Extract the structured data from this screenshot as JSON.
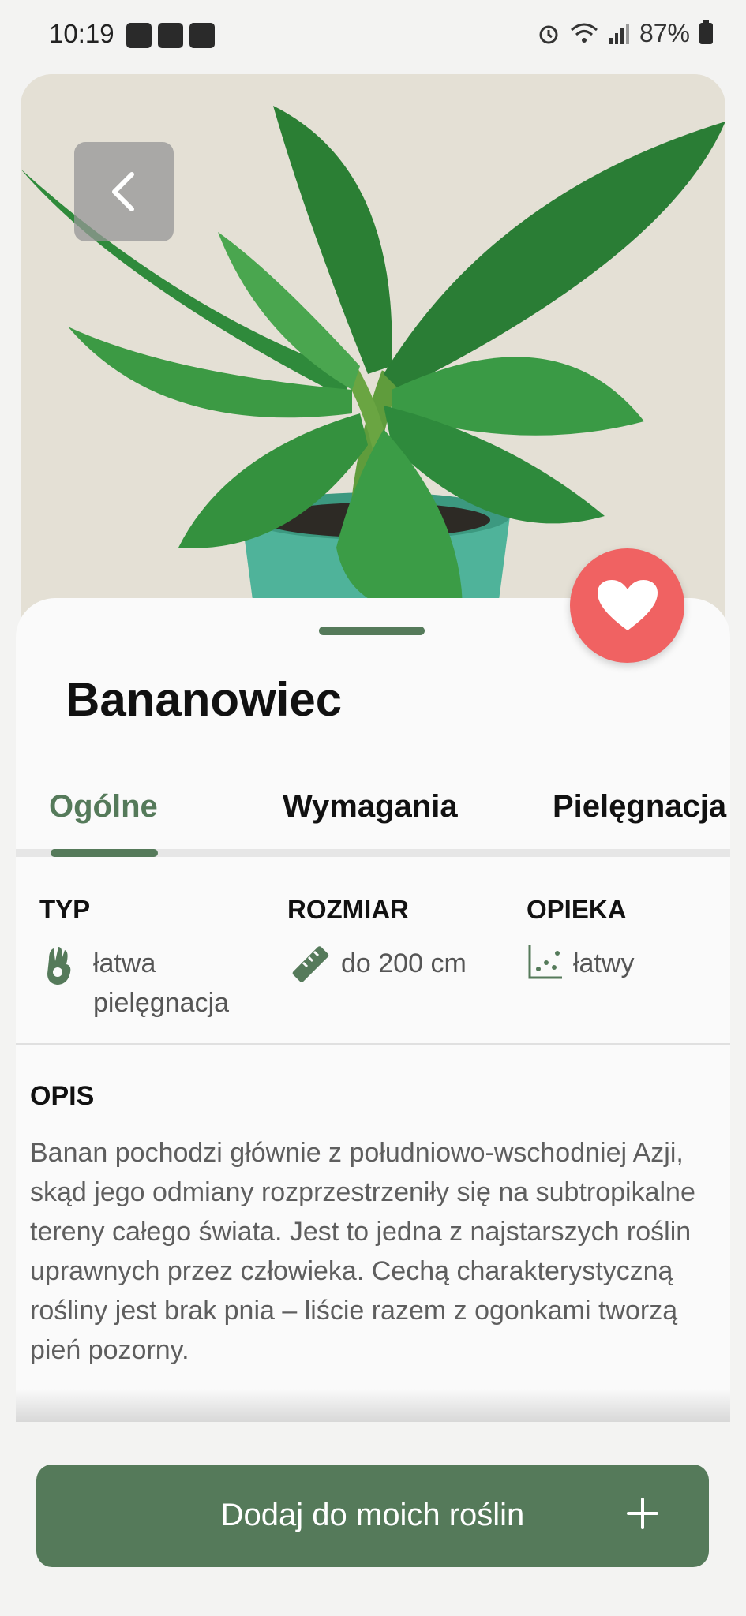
{
  "status_bar": {
    "time": "10:19",
    "battery": "87%"
  },
  "plant": {
    "name": "Bananowiec"
  },
  "tabs": [
    {
      "label": "Ogólne",
      "active": true
    },
    {
      "label": "Wymagania",
      "active": false
    },
    {
      "label": "Pielęgnacja",
      "active": false
    }
  ],
  "info": {
    "type": {
      "header": "TYP",
      "value": "łatwa pielęgnacja"
    },
    "size": {
      "header": "ROZMIAR",
      "value": "do 200 cm"
    },
    "care": {
      "header": "OPIEKA",
      "value": "łatwy"
    }
  },
  "description": {
    "header": "OPIS",
    "text": "Banan pochodzi głównie z południowo-wschodniej Azji, skąd jego odmiany rozprzestrzeniły się na subtropikalne tereny całego świata. Jest to jedna z najstarszych roślin uprawnych przez człowieka. Cechą charakterystyczną rośliny jest brak pnia – liście razem z ogonkami tworzą pień pozorny."
  },
  "cta": {
    "label": "Dodaj do moich roślin"
  },
  "colors": {
    "accent": "#557a5a",
    "favorite": "#f06262"
  },
  "icons": {
    "back": "chevron-left-icon",
    "favorite": "heart-icon",
    "type": "hand-ok-icon",
    "size": "ruler-icon",
    "care": "scatter-chart-icon",
    "add": "plus-icon"
  }
}
